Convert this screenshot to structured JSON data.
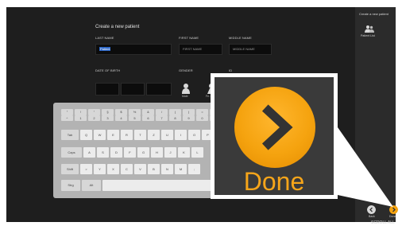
{
  "sidebar": {
    "title": "Create a new patient",
    "patient_list_label": "Patient List"
  },
  "form": {
    "title": "Create a new patient",
    "last_name": {
      "label": "LAST NAME",
      "value": "Patient"
    },
    "first_name": {
      "label": "FIRST NAME",
      "placeholder": "FIRST NAME"
    },
    "middle_name": {
      "label": "MIDDLE NAME",
      "placeholder": "MIDDLE NAME"
    },
    "dob": {
      "label": "DATE OF BIRTH"
    },
    "gender": {
      "label": "GENDER",
      "male": "Male",
      "female": "Fe..."
    },
    "id": {
      "label": "ID"
    }
  },
  "keyboard": {
    "row1": [
      "°",
      "!",
      "\"",
      "§",
      "$",
      "%",
      "&",
      "/",
      "(",
      ")",
      "=",
      "?"
    ],
    "row1_sub": [
      "^",
      "1",
      "2",
      "3",
      "4",
      "5",
      "6",
      "7",
      "8",
      "9",
      "0",
      "ß"
    ],
    "row2": [
      "Tab",
      "Q",
      "W",
      "E",
      "R",
      "T",
      "Z",
      "U",
      "I",
      "O",
      "P"
    ],
    "row3": [
      "Caps",
      "A",
      "S",
      "D",
      "F",
      "G",
      "H",
      "J",
      "K",
      "L"
    ],
    "row4": [
      "Shift",
      ">",
      "Y",
      "X",
      "C",
      "V",
      "B",
      "N",
      "M",
      ";"
    ],
    "row5": [
      "Strg",
      "Alt"
    ]
  },
  "nav": {
    "back_label": "Back",
    "done_label": "Done"
  },
  "zoom": {
    "label": "Done",
    "accent": "#f5a30f"
  },
  "bottom_text": "SCROLL ALL"
}
